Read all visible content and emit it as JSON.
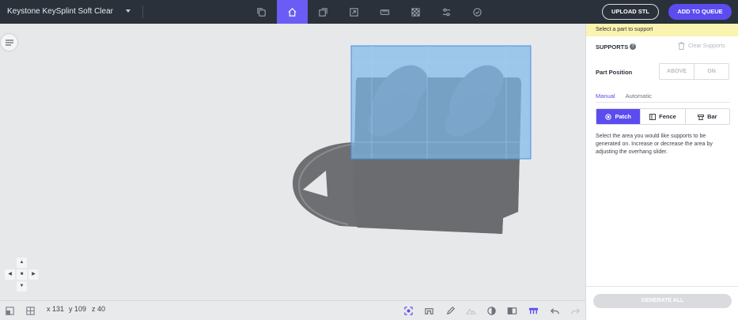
{
  "header": {
    "material": "Keystone KeySplint Soft Clear",
    "tools": [
      {
        "name": "copy-icon"
      },
      {
        "name": "home-icon",
        "active": true
      },
      {
        "name": "duplicate-icon"
      },
      {
        "name": "scale-icon"
      },
      {
        "name": "ruler-icon"
      },
      {
        "name": "checker-icon"
      },
      {
        "name": "sliders-icon"
      },
      {
        "name": "check-circle-icon"
      }
    ],
    "upload_label": "UPLOAD STL",
    "queue_label": "ADD TO QUEUE",
    "accent": "#6b5cf6"
  },
  "bottom": {
    "x": "x 131",
    "y": "y 109",
    "z": "z 40"
  },
  "panel": {
    "hint": "Select a part to support",
    "supports_title": "SUPPORTS",
    "clear_label": "Clear Supports",
    "part_position_label": "Part Position",
    "position_options": [
      "ABOVE",
      "ON"
    ],
    "tabs": [
      "Manual",
      "Automatic"
    ],
    "modes": [
      "Patch",
      "Fence",
      "Bar"
    ],
    "description": "Select the area you would like supports to be generated on. Increase or decrease the area by adjusting the overhang slider.",
    "generate_label": "GENERATE ALL"
  }
}
